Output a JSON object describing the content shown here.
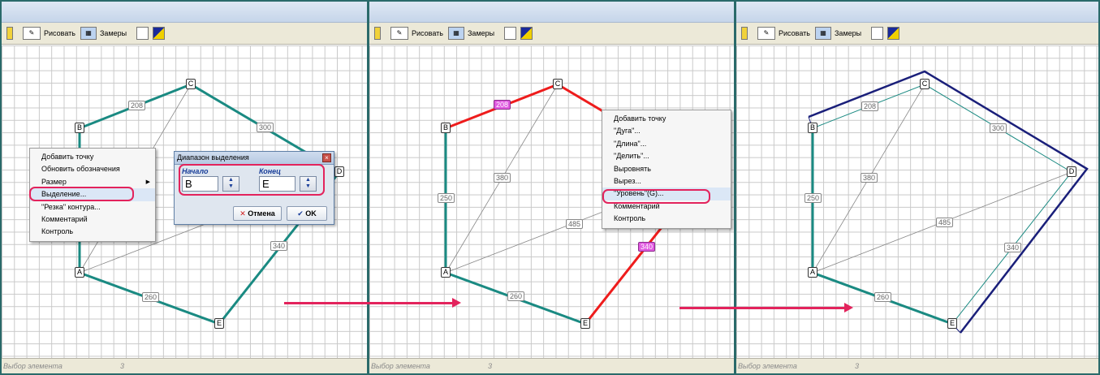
{
  "toolbar": {
    "draw_label": "Рисовать",
    "measures_label": "Замеры"
  },
  "statusbar": {
    "text": "Выбор элемента",
    "count": "3"
  },
  "nodes": {
    "a": "A",
    "b": "B",
    "c": "C",
    "d": "D",
    "e": "E"
  },
  "dims": {
    "d208": "208",
    "d300": "300",
    "d250": "250",
    "d380": "380",
    "d485": "485",
    "d340": "340",
    "d260": "260"
  },
  "panel1": {
    "context_menu": [
      "Добавить точку",
      "Обновить обозначения",
      "Размер",
      "Выделение...",
      "\"Резка\" контура...",
      "Комментарий",
      "Контроль"
    ],
    "dialog": {
      "title": "Диапазон выделения",
      "start_label": "Начало",
      "start_value": "B",
      "end_label": "Конец",
      "end_value": "E",
      "cancel_label": "Отмена",
      "ok_label": "OK"
    }
  },
  "panel2": {
    "context_menu": [
      "Добавить точку",
      "\"Дуга\"...",
      "\"Длина\"...",
      "\"Делить\"...",
      "Выровнять",
      "Вырез...",
      "\"Уровень\"(G)...",
      "Комментарий",
      "Контроль"
    ]
  },
  "colors": {
    "teal": "#1a8a82",
    "red": "#ee1c1c",
    "navy": "#1a1f7a",
    "accent": "#e3235c",
    "magenta": "#e05ae0"
  },
  "icons": [
    "ruler-icon",
    "pencil-icon",
    "measure-icon",
    "frame-icon",
    "color-icon",
    "close-icon",
    "spin-icon",
    "cancel-icon",
    "check-icon",
    "arrow-right-icon"
  ]
}
